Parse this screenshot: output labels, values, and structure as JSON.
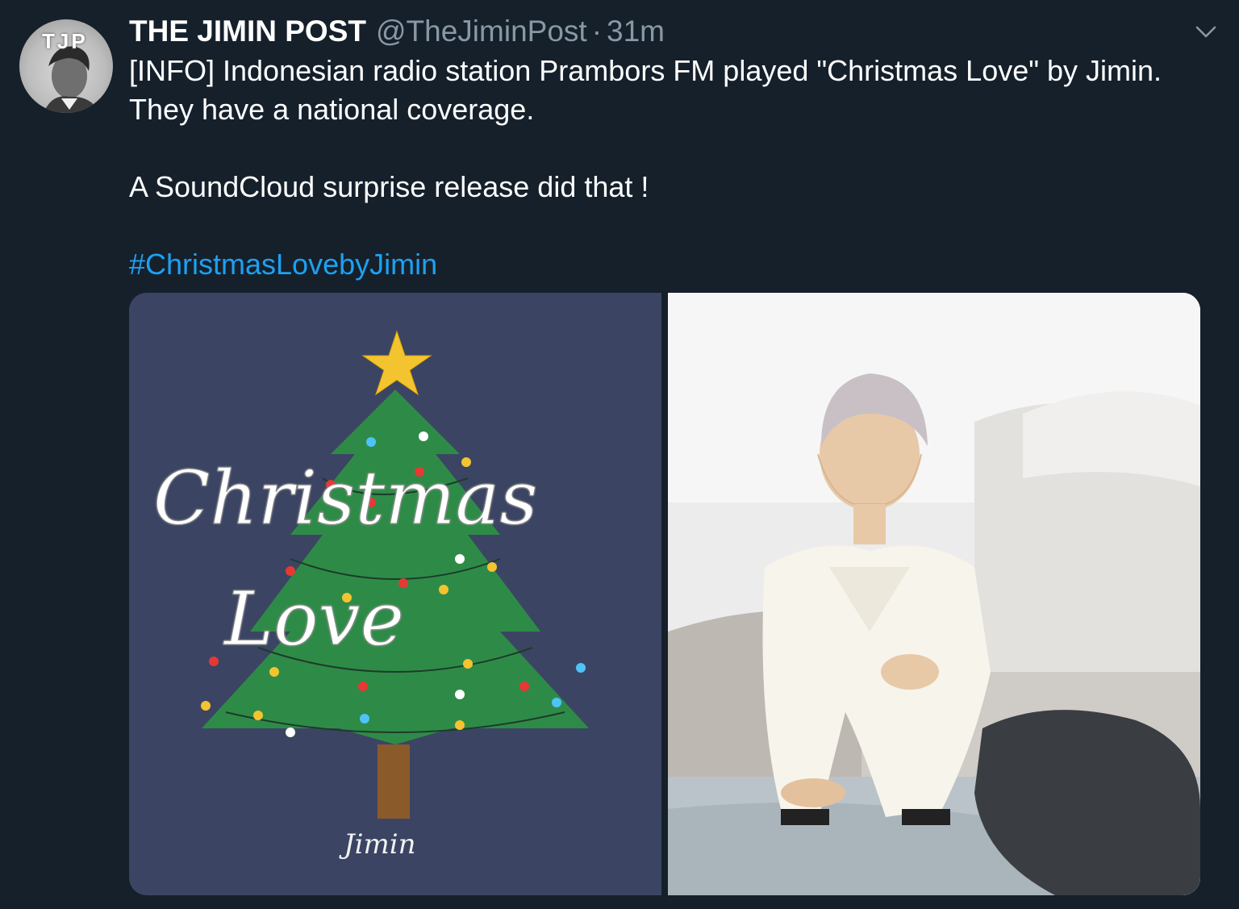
{
  "tweet": {
    "display_name": "THE JIMIN POST",
    "handle": "@TheJiminPost",
    "separator": "·",
    "time": "31m",
    "avatar_text": "TJP",
    "body_line1": "[INFO] Indonesian radio station Prambors FM played \"Christmas Love\" by Jimin. They have a national coverage.",
    "body_line2": "A SoundCloud surprise release did that !",
    "hashtag": "#ChristmasLovebyJimin",
    "icons": {
      "more": "chevron-down-icon"
    }
  },
  "media": {
    "cover": {
      "title_line1": "Christmas",
      "title_line2": "Love",
      "artist_signature": "Jimin"
    }
  },
  "colors": {
    "background": "#15202b",
    "secondary_text": "#8899a6",
    "link": "#1da1f2",
    "cover_background": "#3b4563",
    "tree_green": "#2e8b47"
  }
}
